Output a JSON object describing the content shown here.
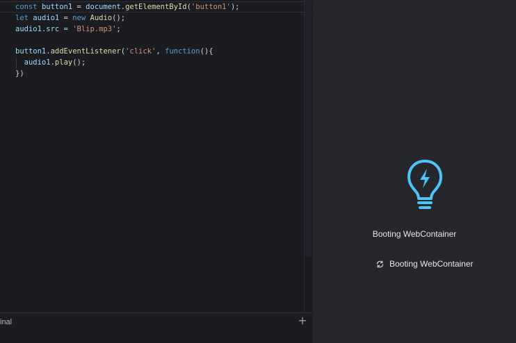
{
  "editor": {
    "lines": [
      [
        "const",
        " ",
        "button1",
        " = ",
        "document",
        ".",
        "getElementById",
        "(",
        "'button1'",
        ");"
      ],
      [
        "let",
        " ",
        "audio1",
        " = ",
        "new",
        " ",
        "Audio",
        "();"
      ],
      [
        "audio1",
        ".src = ",
        "'Blip.mp3'",
        ";"
      ],
      [
        ""
      ],
      [
        "button1",
        ".",
        "addEventListener",
        "(",
        "'click'",
        ", ",
        "function",
        "(){"
      ],
      [
        "  ",
        "audio1",
        ".",
        "play",
        "();"
      ],
      [
        "})"
      ]
    ]
  },
  "terminal": {
    "label": "inal"
  },
  "preview": {
    "title": "Booting WebContainer",
    "status": "Booting WebContainer",
    "icons": {
      "bulb": "lightbulb-bolt-icon",
      "spinner": "refresh-icon",
      "add": "plus-icon"
    },
    "accent": "#4fc3f7"
  }
}
